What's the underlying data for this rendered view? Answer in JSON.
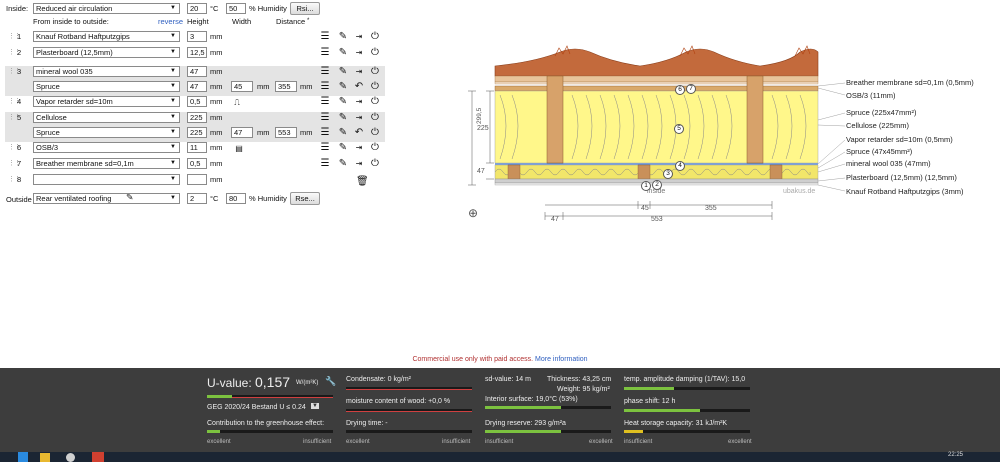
{
  "inside": {
    "label": "Inside:",
    "select": "Reduced air circulation",
    "temp": "20",
    "temp_unit": "°C",
    "humidity": "50",
    "humidity_unit": "% Humidity",
    "button": "Rsi..."
  },
  "headers": {
    "from": "From inside to outside:",
    "reverse": "reverse",
    "height": "Height",
    "width": "Width",
    "distance": "Distance",
    "distance_marker": "*"
  },
  "unit": "mm",
  "layers": [
    {
      "num": "1",
      "material": "Knauf Rotband Haftputzgips",
      "height": "3"
    },
    {
      "num": "2",
      "material": "Plasterboard (12,5mm)",
      "height": "12,5"
    },
    {
      "num": "3",
      "material": "mineral wool 035",
      "height": "47",
      "sub": {
        "material": "Spruce",
        "height": "47",
        "width": "45",
        "distance": "355"
      }
    },
    {
      "num": "4",
      "material": "Vapor retarder sd=10m",
      "height": "0,5"
    },
    {
      "num": "5",
      "material": "Cellulose",
      "height": "225",
      "sub": {
        "material": "Spruce",
        "height": "225",
        "width": "47",
        "distance": "553"
      }
    },
    {
      "num": "6",
      "material": "OSB/3",
      "height": "11"
    },
    {
      "num": "7",
      "material": "Breather membrane sd=0,1m",
      "height": "0,5"
    },
    {
      "num": "8",
      "material": "",
      "height": ""
    }
  ],
  "outside": {
    "label": "Outside",
    "select": "Rear ventilated roofing",
    "temp": "2",
    "temp_unit": "°C",
    "humidity": "80",
    "humidity_unit": "% Humidity",
    "button": "Rse..."
  },
  "drawing": {
    "labels": [
      "Breather membrane sd=0,1m (0,5mm)",
      "OSB/3 (11mm)",
      "Spruce (225x47mm²)",
      "Cellulose (225mm)",
      "Vapor retarder sd=10m (0,5mm)",
      "Spruce (47x45mm²)",
      "mineral wool 035 (47mm)",
      "Plasterboard (12,5mm) (12,5mm)",
      "Knauf Rotband Haftputzgips (3mm)"
    ],
    "dim_total": "299,5",
    "dim_225": "225",
    "dim_47": "47",
    "dim_45": "45",
    "dim_355": "355",
    "dim_47b": "47",
    "dim_553": "553",
    "inside_text": "inside",
    "watermark": "ubakus.de",
    "markers": [
      "1",
      "2",
      "3",
      "4",
      "5",
      "6",
      "7"
    ]
  },
  "notice": {
    "text": "Commercial use only with paid access.",
    "link": "More information"
  },
  "footer": {
    "u_label": "U-value:",
    "u_value": "0,157",
    "u_unit": "W/(m²K)",
    "geg": "GEG 2020/24 Bestand U ≤ 0.24",
    "greenhouse": "Contribution to the greenhouse effect:",
    "excellent": "excellent",
    "insufficient": "insufficient",
    "condensate": "Condensate: 0 kg/m²",
    "moisture": "moisture content of wood: +0,0 %",
    "drying_time": "Drying time: -",
    "sd": "sd-value: 14 m",
    "thickness": "Thickness: 43,25 cm",
    "weight": "Weight: 95 kg/m²",
    "surface": "Interior surface: 19,0°C (53%)",
    "reserve": "Drying reserve: 293 g/m²a",
    "amplitude": "temp. amplitude damping (1/TAV): 15,0",
    "phase": "phase shift: 12 h",
    "heat": "Heat storage capacity: 31 kJ/m²K",
    "bars": {
      "u": 0.2,
      "greenhouse": 0.1,
      "condensate": 0.0,
      "moisture": 0.0,
      "drying": 0.0,
      "surface": 0.6,
      "reserve": 0.6,
      "amplitude": 0.4,
      "phase": 0.6,
      "heat": 0.15
    }
  },
  "taskbar": {
    "time": "22:25"
  }
}
